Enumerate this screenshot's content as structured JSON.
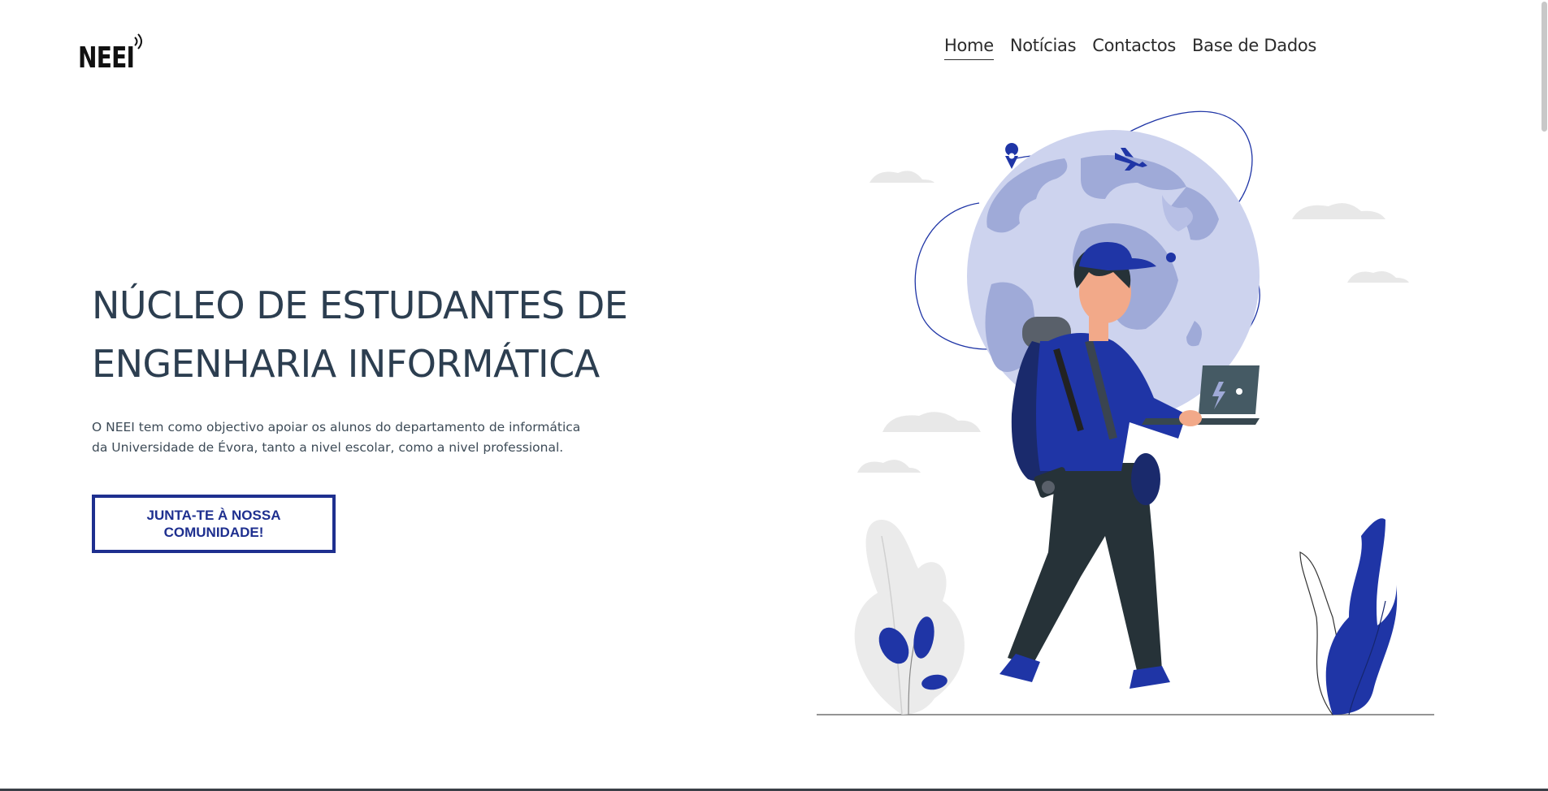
{
  "header": {
    "logo_text": "NEEI",
    "nav": [
      {
        "label": "Home",
        "active": true
      },
      {
        "label": "Notícias",
        "active": false
      },
      {
        "label": "Contactos",
        "active": false
      },
      {
        "label": "Base de Dados",
        "active": false
      }
    ]
  },
  "hero": {
    "title_line1": "NÚCLEO DE ESTUDANTES DE",
    "title_line2": "ENGENHARIA INFORMÁTICA",
    "description_line1": "O NEEI tem como objectivo apoiar os alunos do departamento de informática",
    "description_line2": "da Universidade de Évora, tanto a nivel escolar, como a nivel professional.",
    "cta_label": "JUNTA-TE À NOSSA COMUNIDADE!"
  },
  "colors": {
    "primary": "#1e2f8f",
    "accent_blue": "#1f35a6",
    "globe_light": "#cdd3ee",
    "globe_dark": "#9faad8",
    "text_dark": "#2c3e50",
    "pants": "#263238",
    "cloud": "#e6e6e6"
  },
  "illustration": {
    "icon": "traveler-with-laptop-globe-illustration"
  }
}
